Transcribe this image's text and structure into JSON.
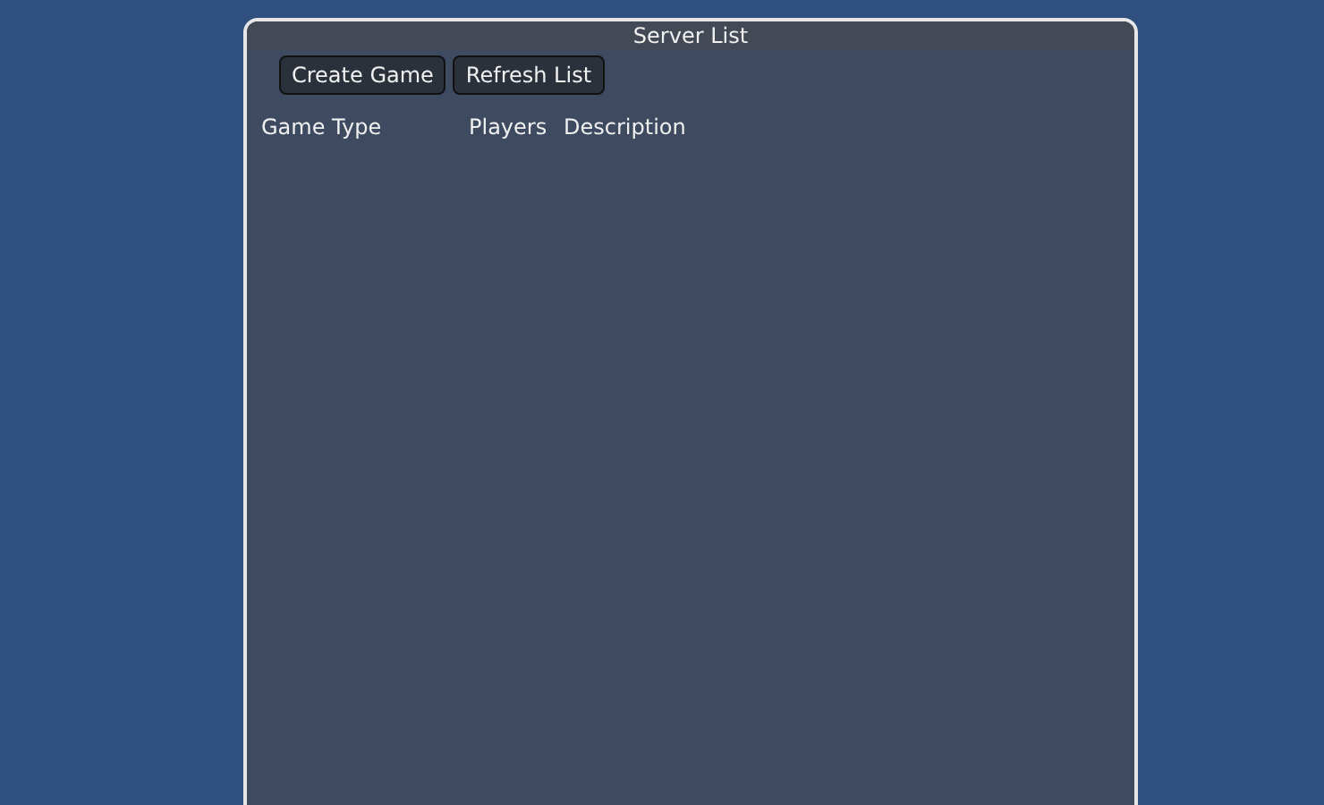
{
  "window": {
    "title": "Server List"
  },
  "buttons": [
    "Create Game",
    "Refresh List"
  ],
  "table": {
    "columns": [
      "Game Type",
      "Players",
      "Description"
    ]
  }
}
